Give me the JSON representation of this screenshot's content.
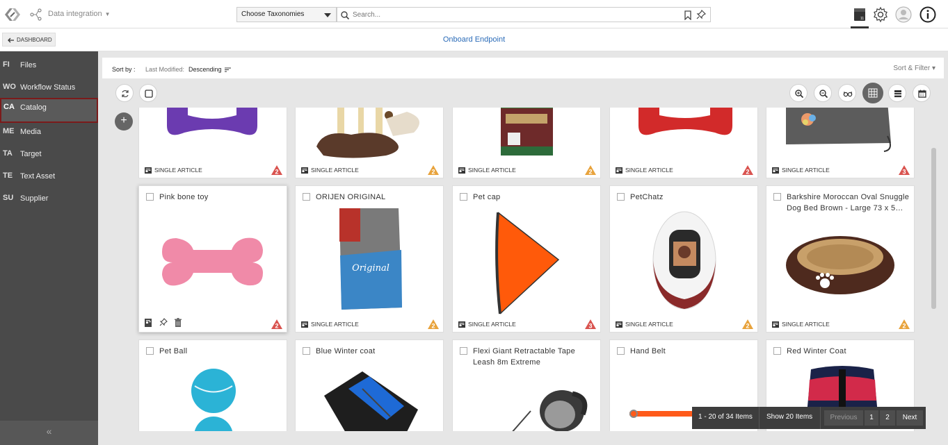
{
  "header": {
    "app_title": "Data integration",
    "taxonomy_select": "Choose Taxonomies",
    "search_placeholder": "Search..."
  },
  "subheader": {
    "dashboard_label": "DASHBOARD",
    "page_title": "Onboard Endpoint"
  },
  "sidebar": {
    "items": [
      {
        "abbr": "FI",
        "label": "Files"
      },
      {
        "abbr": "WO",
        "label": "Workflow Status"
      },
      {
        "abbr": "CA",
        "label": "Catalog"
      },
      {
        "abbr": "ME",
        "label": "Media"
      },
      {
        "abbr": "TA",
        "label": "Target"
      },
      {
        "abbr": "TE",
        "label": "Text Asset"
      },
      {
        "abbr": "SU",
        "label": "Supplier"
      }
    ],
    "collapse_glyph": "«"
  },
  "sortbar": {
    "sort_label": "Sort by :",
    "sort_field": "Last Modified:",
    "sort_value": "Descending",
    "sort_filter": "Sort & Filter"
  },
  "cards_top": [
    {
      "footer": "SINGLE ARTICLE",
      "badge": "2",
      "badge_color": "#d9534f"
    },
    {
      "footer": "SINGLE ARTICLE",
      "badge": "2",
      "badge_color": "#e8a33c"
    },
    {
      "footer": "SINGLE ARTICLE",
      "badge": "2",
      "badge_color": "#e8a33c"
    },
    {
      "footer": "SINGLE ARTICLE",
      "badge": "2",
      "badge_color": "#d9534f"
    },
    {
      "footer": "SINGLE ARTICLE",
      "badge": "3",
      "badge_color": "#d9534f"
    }
  ],
  "cards_mid": [
    {
      "title": "Pink bone toy",
      "footer": "",
      "badge": "2",
      "badge_color": "#d9534f"
    },
    {
      "title": "ORIJEN ORIGINAL",
      "footer": "SINGLE ARTICLE",
      "badge": "2",
      "badge_color": "#e8a33c"
    },
    {
      "title": "Pet cap",
      "footer": "SINGLE ARTICLE",
      "badge": "3",
      "badge_color": "#d9534f"
    },
    {
      "title": "PetChatz",
      "footer": "SINGLE ARTICLE",
      "badge": "2",
      "badge_color": "#e8a33c"
    },
    {
      "title": "Barkshire Moroccan Oval Snuggle Dog Bed Brown - Large 73 x 5…",
      "footer": "SINGLE ARTICLE",
      "badge": "2",
      "badge_color": "#e8a33c"
    }
  ],
  "cards_bottom": [
    {
      "title": "Pet Ball"
    },
    {
      "title": "Blue Winter coat"
    },
    {
      "title": "Flexi Giant Retractable Tape Leash 8m Extreme"
    },
    {
      "title": "Hand Belt"
    },
    {
      "title": "Red Winter Coat"
    }
  ],
  "pager": {
    "range": "1 - 20 of 34 Items",
    "show": "Show 20 Items",
    "previous": "Previous",
    "page1": "1",
    "page2": "2",
    "next": "Next"
  },
  "icons": [
    "logo-icon",
    "flow-icon",
    "search-icon",
    "bookmark-icon",
    "pin-icon",
    "catalog-icon",
    "settings-icon",
    "user-icon",
    "info-icon",
    "refresh-icon",
    "select-all-icon",
    "add-icon",
    "zoom-in-icon",
    "zoom-out-icon",
    "glasses-icon",
    "grid-view-icon",
    "list-view-icon",
    "calendar-icon"
  ]
}
